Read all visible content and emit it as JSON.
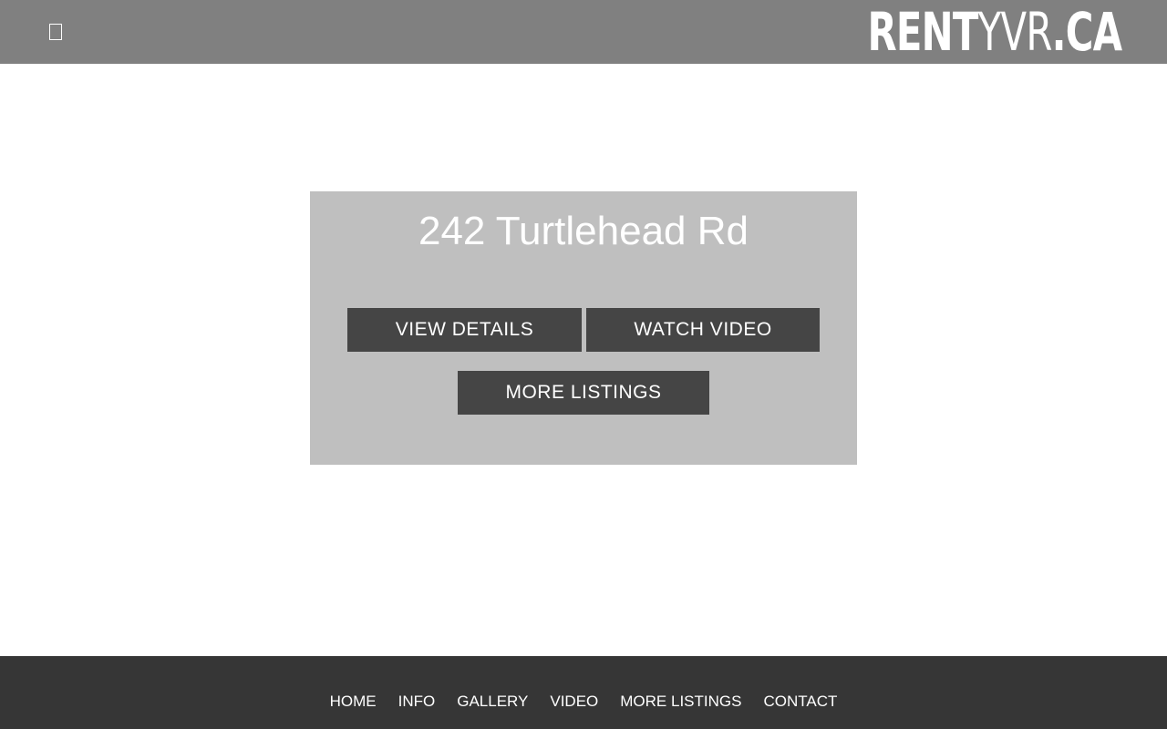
{
  "header": {
    "menu_icon": "menu-square-icon",
    "logo_bold": "RENT",
    "logo_thin": "YVR",
    "logo_suffix": ".CA"
  },
  "listing": {
    "address": "242 Turtlehead Rd",
    "buttons": {
      "view_details": "VIEW DETAILS",
      "watch_video": "WATCH VIDEO",
      "more_listings": "MORE LISTINGS"
    }
  },
  "footer": {
    "links": [
      "HOME",
      "INFO",
      "GALLERY",
      "VIDEO",
      "MORE LISTINGS",
      "CONTACT"
    ]
  },
  "colors": {
    "header_bg": "#808080",
    "card_bg": "#bfbfbf",
    "button_bg": "#454545",
    "footer_bg": "#363636",
    "text": "#ffffff"
  }
}
